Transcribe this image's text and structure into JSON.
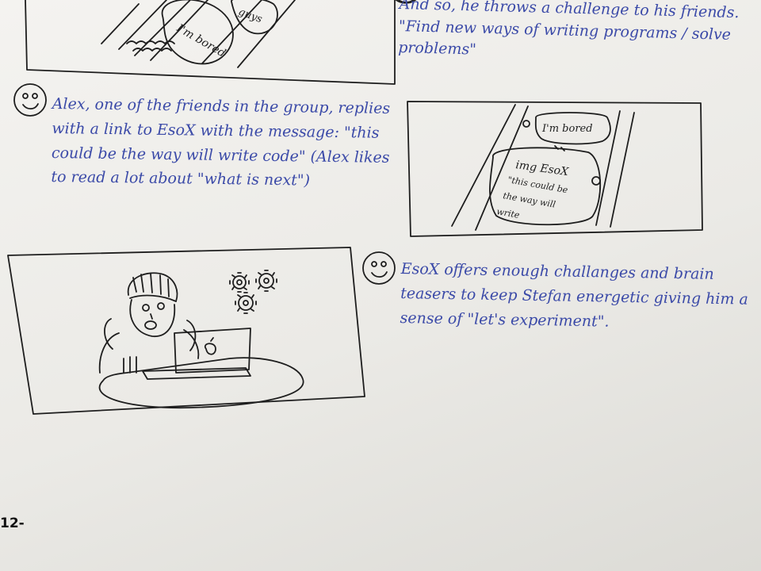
{
  "captions": {
    "top_right": "And so, he throws a challenge to his friends. \"Find new ways of writing programs / solve problems\"",
    "alex": "Alex, one of the friends in the group, replies with a link to EsoX with the message: \"this could be the way will write code\" (Alex likes to read a lot about \"what is next\")",
    "esox": "EsoX offers enough challanges and brain teasers to keep Stefan energetic giving him a sense of \"let's experiment\"."
  },
  "sketch_text": {
    "bubble_bored_top": "I'm bored",
    "bubble_guys": "guys",
    "phone_bubble_bored": "I'm bored",
    "phone_bubble_link": "img EsoX",
    "phone_bubble_msg_1": "\"this could be",
    "phone_bubble_msg_2": "the way will",
    "phone_bubble_msg_3": "write"
  },
  "page_number": "12-",
  "colors": {
    "ink_blue": "#3b4aa8",
    "pencil": "#1e1e1e",
    "paper": "#efeeea"
  }
}
